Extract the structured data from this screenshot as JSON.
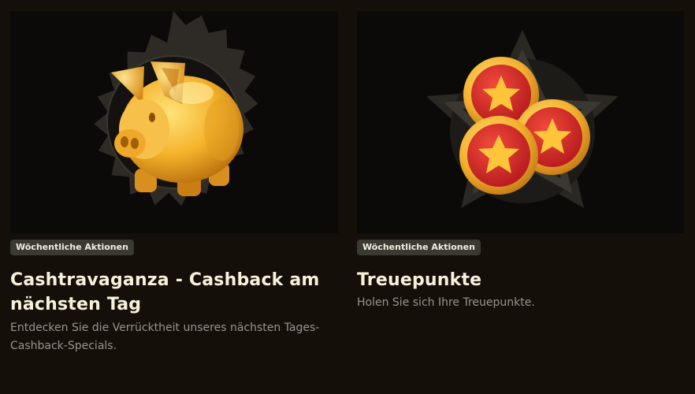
{
  "promotions": [
    {
      "image_icon": "piggy-bank-icon",
      "badge": "Wöchentliche Aktionen",
      "title": "Cashtravaganza - Cashback am nächsten Tag",
      "description": "Entdecken Sie die Verrücktheit unseres nächsten Tages-Cashback-Specials."
    },
    {
      "image_icon": "coins-star-icon",
      "badge": "Wöchentliche Aktionen",
      "title": "Treuepunkte",
      "description": "Holen Sie sich Ihre Treuepunkte."
    }
  ],
  "colors": {
    "page_background": "#140f08",
    "card_image_background": "#0c0a08",
    "badge_background": "#3a3a30",
    "title_text": "#f7f1dc",
    "description_text": "#9a958a",
    "gold": "#f5b72e",
    "coin_red": "#d8262a"
  }
}
